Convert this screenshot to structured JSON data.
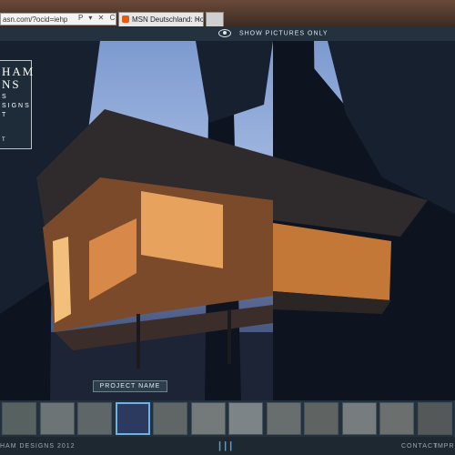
{
  "browser": {
    "address": "asn.com/?ocid=iehp",
    "address_icons": "P ▾ ✕ C",
    "tab_title": "MSN Deutschland: Hotmail...",
    "tab_close": "×"
  },
  "toolbar": {
    "show_pictures_label": "SHOW PICTURES ONLY"
  },
  "logo": {
    "line1": "HAM",
    "line2": "NS"
  },
  "menu": {
    "items": [
      "S",
      "SIGNS",
      "T",
      "T"
    ]
  },
  "project": {
    "name_label": "PROJECT NAME"
  },
  "thumbnails": {
    "count": 12,
    "active_index": 3,
    "tones": [
      "#7f8576",
      "#a4a79b",
      "#8a8c84",
      "#2c3a60",
      "#8e8d80",
      "#b2b0a4",
      "#c3c4bd",
      "#9d9a8d",
      "#8c8878",
      "#b8b7ae",
      "#a29f90",
      "#7a7466"
    ]
  },
  "footer": {
    "copyright": "HAM DESIGNS 2012",
    "pager": "|||",
    "contact": "CONTACT",
    "imprint": "IMPR"
  },
  "colors": {
    "accent": "#4aa3df",
    "panel": "#24303c"
  }
}
